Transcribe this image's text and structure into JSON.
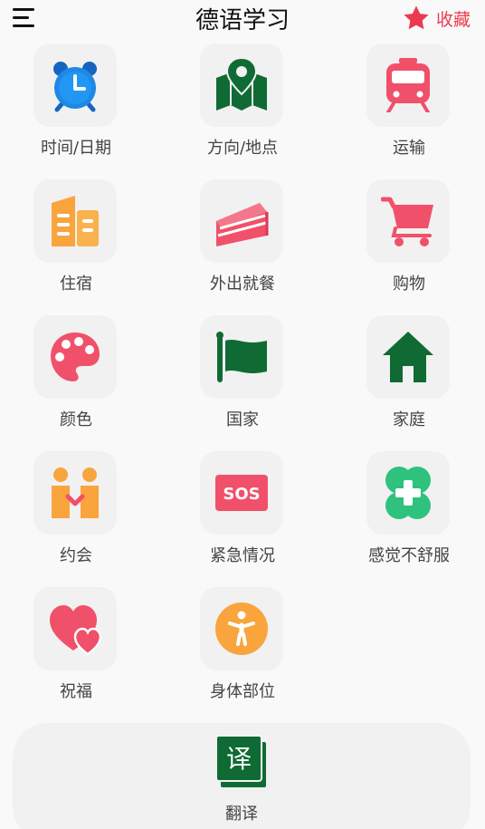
{
  "header": {
    "title": "德语学习",
    "favorites_label": "收藏"
  },
  "categories": [
    {
      "label": "时间/日期",
      "icon": "alarm-clock-icon"
    },
    {
      "label": "方向/地点",
      "icon": "map-pin-icon"
    },
    {
      "label": "运输",
      "icon": "train-icon"
    },
    {
      "label": "住宿",
      "icon": "buildings-icon"
    },
    {
      "label": "外出就餐",
      "icon": "cake-icon"
    },
    {
      "label": "购物",
      "icon": "shopping-cart-icon"
    },
    {
      "label": "颜色",
      "icon": "palette-icon"
    },
    {
      "label": "国家",
      "icon": "flag-icon"
    },
    {
      "label": "家庭",
      "icon": "house-icon"
    },
    {
      "label": "约会",
      "icon": "couple-icon"
    },
    {
      "label": "紧急情况",
      "icon": "sos-icon",
      "icon_text": "SOS"
    },
    {
      "label": "感觉不舒服",
      "icon": "medical-cross-icon"
    },
    {
      "label": "祝福",
      "icon": "hearts-icon"
    },
    {
      "label": "身体部位",
      "icon": "body-icon"
    }
  ],
  "translate": {
    "label": "翻译",
    "icon_text": "译",
    "icon": "translate-icon"
  },
  "colors": {
    "accent_red": "#ec3b4f",
    "primary_green": "#0f6b33",
    "orange": "#f9a43d",
    "pink": "#f1506a"
  }
}
